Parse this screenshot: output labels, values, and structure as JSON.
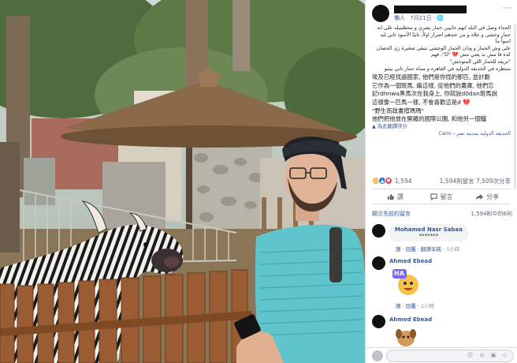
{
  "post": {
    "meta_page": "懶人",
    "meta_time": "7月21日 · 🌐",
    "more_glyph": "···",
    "arabic_lines": [
      "الحداء وصل في البلد انهم حابيين حمار بشري و محطينيله على انه",
      "حمار وحشي و علاه و من عندهم اصرار اولاً، ثانيًا الأسود ثاني ليه اسوأ ما",
      "على وش الحمار و ودان الحمار الوحشي بتبقي صغيرة زي الحصان",
      "كده فا مش بد يعني مش 💔 \"D\"، فهم"
    ],
    "arabic_tag": "\"تريقه للحمار اللي المتوحش\"",
    "arabic_loc": "متنظره في الحديقة الدولية في القاهره و مماه حمار ثاني بيتبو",
    "zh_lines": [
      "埃及已經找遍國家, 他們是你找的那匹, 並計劃",
      "它作為一個斑馬, 繼這樣, 從他們的畫庫, 他們忘",
      "記rdhnwa黑馬次在我身上, 你就說d0dan斑馬說",
      "這樣像一匹馬一樣, 不會喜歡這是d 💔",
      "\"野生而政畫撐瑪瑪\"",
      "他們把他放在開羅的國際公園, 和他另一個驢"
    ],
    "translate_label": "為此翻譯評分",
    "location": "الحديقة الدولية بمدينة نصر - Cairo"
  },
  "stats": {
    "reaction_icons": [
      "haha",
      "like",
      "love"
    ],
    "reaction_count": "1,594",
    "comment_share": "1,594則留言 7,509次分享"
  },
  "actions": {
    "like": "讚",
    "comment": "留言",
    "share": "分享"
  },
  "comments_header": {
    "sort_label": "顯示先前的留言",
    "count": "1,594則中的6則"
  },
  "comments": [
    {
      "name": "Mohamed Nasr Sabaa",
      "text": "*******",
      "links": "讚 · 回覆 · 翻譯年糕 ·",
      "time": "5小時"
    },
    {
      "name": "Ahmed Ebead",
      "text": "",
      "sticker_text": "HA",
      "links": "讚 · 回覆 ·",
      "time": "2小時"
    },
    {
      "name": "Ahmed Ebead",
      "text": ""
    }
  ],
  "composer": {
    "icons": "☺ ◎ ▣ ◇"
  },
  "colors": {
    "link": "#385898",
    "bubble": "#f2f3f5",
    "haha": "#f7b125",
    "like": "#1877f2",
    "love": "#f33e58"
  }
}
